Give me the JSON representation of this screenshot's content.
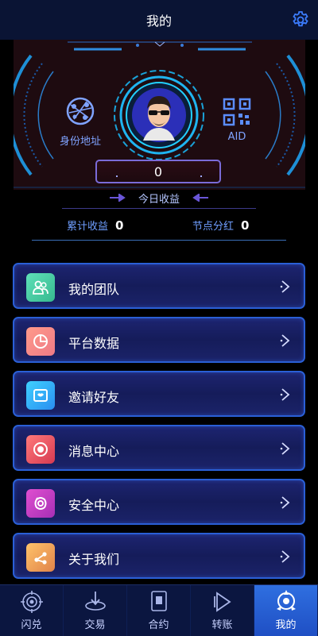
{
  "header": {
    "title": "我的",
    "settings_icon": "gear-icon"
  },
  "hero": {
    "left_label": "身份地址",
    "left_icon": "globe-network-icon",
    "right_label": "AID",
    "right_icon": "qr-code-icon",
    "today_value": "0",
    "today_label": "今日收益"
  },
  "stats": [
    {
      "label": "累计收益",
      "value": "0"
    },
    {
      "label": "节点分红",
      "value": "0"
    }
  ],
  "menu": [
    {
      "label": "我的团队",
      "icon": "team-icon",
      "color": "#4fd1a8"
    },
    {
      "label": "平台数据",
      "icon": "pie-chart-icon",
      "color": "#f08a8a"
    },
    {
      "label": "邀请好友",
      "icon": "invite-envelope-icon",
      "color": "#2fb4f0"
    },
    {
      "label": "消息中心",
      "icon": "message-icon",
      "color": "#e8535a"
    },
    {
      "label": "安全中心",
      "icon": "shield-icon",
      "color": "#c93ec0"
    },
    {
      "label": "关于我们",
      "icon": "share-nodes-icon",
      "color": "#f0a24a"
    }
  ],
  "tabs": [
    {
      "label": "闪兑",
      "icon": "swap-target-icon",
      "active": false
    },
    {
      "label": "交易",
      "icon": "trade-icon",
      "active": false
    },
    {
      "label": "合约",
      "icon": "contract-icon",
      "active": false
    },
    {
      "label": "转账",
      "icon": "transfer-icon",
      "active": false
    },
    {
      "label": "我的",
      "icon": "profile-icon",
      "active": true
    }
  ]
}
